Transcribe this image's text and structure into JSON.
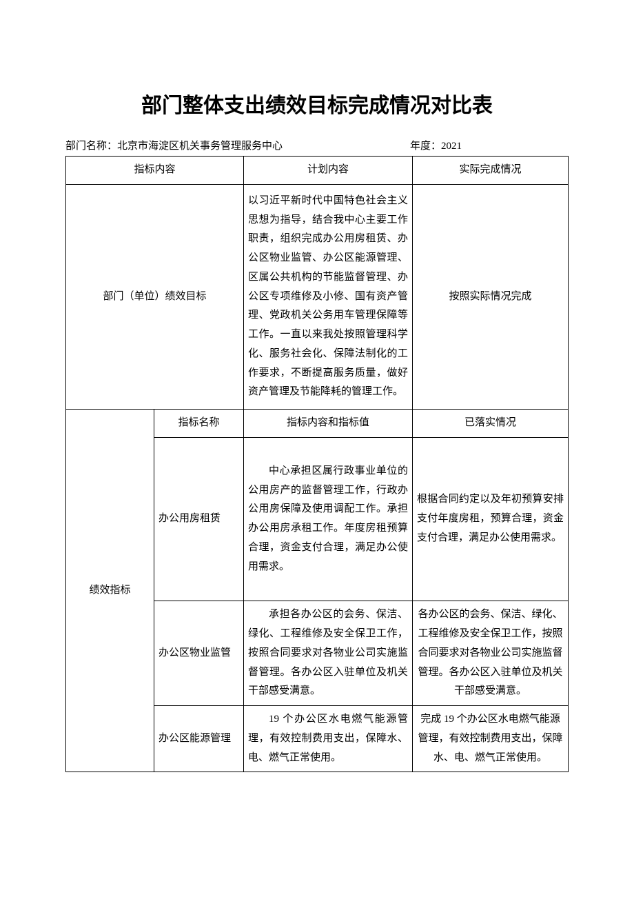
{
  "title": "部门整体支出绩效目标完成情况对比表",
  "meta": {
    "dept_label": "部门名称：",
    "dept_value": "北京市海淀区机关事务管理服务中心",
    "year_label": "年度：",
    "year_value": "2021"
  },
  "headers": {
    "indicator_content": "指标内容",
    "plan_content": "计划内容",
    "actual_status": "实际完成情况",
    "indicator_name": "指标名称",
    "indicator_content_value": "指标内容和指标值",
    "implemented_status": "已落实情况"
  },
  "row_labels": {
    "dept_goal": "部门（单位）绩效目标",
    "performance_indicator": "绩效指标"
  },
  "dept_goal": {
    "plan": "以习近平新时代中国特色社会主义思想为指导，结合我中心主要工作职责，组织完成办公用房租赁、办公区物业监管、办公区能源管理、区属公共机构的节能监督管理、办公区专项维修及小修、国有资产管理、党政机关公务用车管理保障等工作。一直以来我处按照管理科学化、服务社会化、保障法制化的工作要求，不断提高服务质量，做好资产管理及节能降耗的管理工作。",
    "actual": "按照实际情况完成"
  },
  "indicators": [
    {
      "name": "办公用房租赁",
      "content": "中心承担区属行政事业单位的公用房产的监督管理工作，行政办公用房保障及使用调配工作。承担办公用房承租工作。年度房租预算合理，资金支付合理，满足办公使用需求。",
      "status": "根据合同约定以及年初预算安排支付年度房租，预算合理，资金支付合理，满足办公使用需求。"
    },
    {
      "name": "办公区物业监管",
      "content": "承担各办公区的会务、保洁、绿化、工程维修及安全保卫工作，按照合同要求对各物业公司实施监督管理。各办公区入驻单位及机关干部感受满意。",
      "status": "各办公区的会务、保洁、绿化、工程维修及安全保卫工作，按照合同要求对各物业公司实施监督管理。各办公区入驻单位及机关干部感受满意。"
    },
    {
      "name": "办公区能源管理",
      "content": "19 个办公区水电燃气能源管理，有效控制费用支出，保障水、电、燃气正常使用。",
      "status": "完成 19 个办公区水电燃气能源管理，有效控制费用支出，保障水、电、燃气正常使用。"
    }
  ]
}
